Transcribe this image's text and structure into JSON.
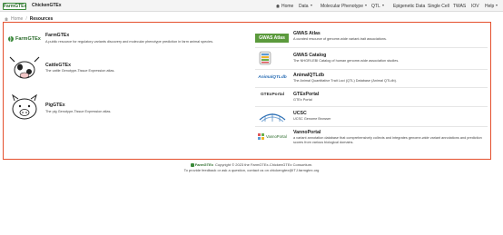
{
  "navbar": {
    "brand_logo_text": "FarmGTEx",
    "brand_name": "ChickenGTEx",
    "items": [
      {
        "label": "Home",
        "icon": "home-icon"
      },
      {
        "label": "Data"
      },
      {
        "label": "Molecular Phenotype"
      },
      {
        "label": "QTL"
      },
      {
        "label": "Epigenetic Data"
      },
      {
        "label": "Single Cell"
      },
      {
        "label": "TWAS"
      },
      {
        "label": "IOV"
      },
      {
        "label": "Help"
      }
    ]
  },
  "breadcrumb": {
    "home": "Home",
    "separator": "/",
    "current": "Resources"
  },
  "resources_left": [
    {
      "title": "FarmGTEx",
      "description": "A public resource for regulatory variants discovery and molecular phenotype prediction in farm animal species.",
      "logo_text": "FarmGTEx"
    },
    {
      "title": "CattleGTEx",
      "description": "The cattle Genotype-Tissue Expression atlas.",
      "logo_icon": "cattle-icon"
    },
    {
      "title": "PigGTEx",
      "description": "The pig Genotype-Tissue Expression atlas.",
      "logo_icon": "pig-icon"
    }
  ],
  "resources_right": [
    {
      "title": "GWAS Atlas",
      "description": "A curated resource of genome-wide variant-trait associations.",
      "logo_text": "GWAS Atlas"
    },
    {
      "title": "GWAS Catalog",
      "description": "The NHGRI-EBI Catalog of human genome-wide association studies.",
      "logo_icon": "gwas-catalog-icon"
    },
    {
      "title": "AnimalQTLdb",
      "description": "The Animal Quantitative Trait Loci (QTL) Database (Animal QTLdb).",
      "logo_text": "AnimalQTLdb"
    },
    {
      "title": "GTExPortal",
      "description": "GTEx Portal",
      "logo_text": "GTExPortal"
    },
    {
      "title": "UCSC",
      "description": "UCSC Genome Browser",
      "logo_icon": "ucsc-icon"
    },
    {
      "title": "VannoPortal",
      "description": "a variant annotation database that comprehensively collects and integrates genome-wide variant annotations and prediction scores from various biological domains.",
      "logo_text": "VannoPortal"
    }
  ],
  "footer": {
    "copyright": "Copyright © 2023 the FarmGTEx-ChickenGTEx Consortium.",
    "logo_text": "FarmGTEx",
    "feedback": "To provide feedback or ask a question, contact us on chickengtex@ITJ.farmgtex.org"
  },
  "colors": {
    "highlight_border": "#e4502d",
    "brand_green": "#3a8a3a",
    "gwas_atlas_green": "#5b9a3c",
    "link_blue": "#2c6fb5"
  }
}
